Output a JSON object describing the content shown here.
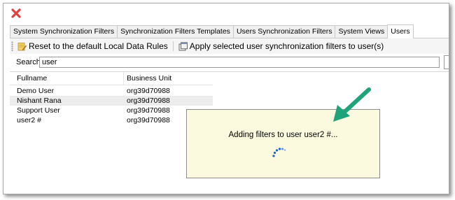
{
  "tabs": [
    {
      "label": "System Synchronization Filters",
      "active": false
    },
    {
      "label": "Synchronization Filters Templates",
      "active": false
    },
    {
      "label": "Users Synchronization Filters",
      "active": false
    },
    {
      "label": "System Views",
      "active": false
    },
    {
      "label": "Users",
      "active": true
    }
  ],
  "toolbar": {
    "reset_label": "Reset to the default Local Data Rules",
    "apply_label": "Apply selected user synchronization filters to user(s)"
  },
  "search": {
    "label": "Search",
    "value": "user"
  },
  "table": {
    "columns": [
      "Fullname",
      "Business Unit"
    ],
    "rows": [
      {
        "fullname": "Demo User",
        "business_unit": "org39d70988"
      },
      {
        "fullname": "Nishant Rana",
        "business_unit": "org39d70988"
      },
      {
        "fullname": "Support User",
        "business_unit": "org39d70988"
      },
      {
        "fullname": "user2 #",
        "business_unit": "org39d70988"
      }
    ],
    "selected_row": 1
  },
  "popup": {
    "message": "Adding filters to user user2 #..."
  },
  "icons": {
    "close": "close-x-icon",
    "reset": "notepad-pencil-icon",
    "apply": "apply-window-icon",
    "spinner": "loading-spinner-icon",
    "annotation": "green-arrow-icon"
  },
  "colors": {
    "close_red": "#e04040",
    "popup_bg": "#fcfade",
    "spinner_blue": "#1f5fbf",
    "arrow_green": "#1fa37a"
  }
}
